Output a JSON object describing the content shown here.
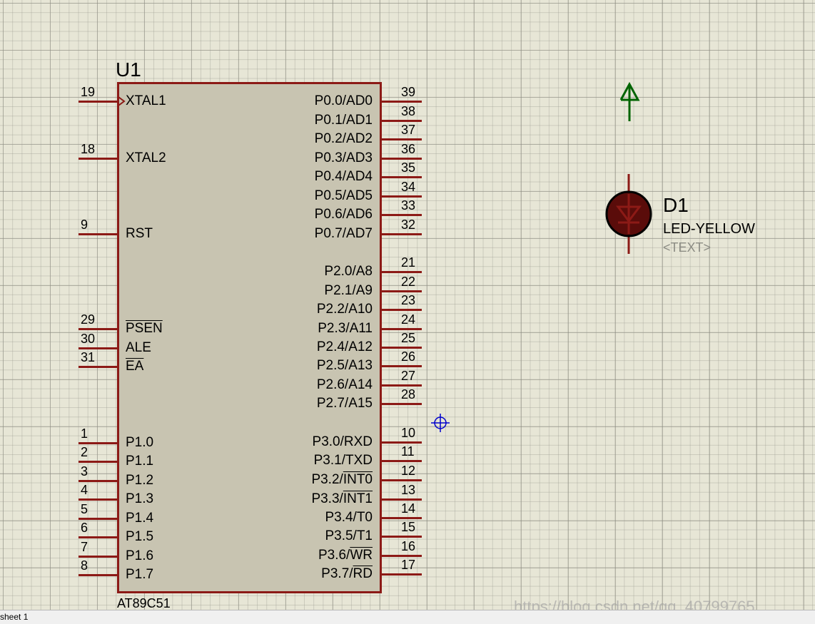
{
  "component": {
    "ref": "U1",
    "part": "AT89C51",
    "left_pins": [
      {
        "num": "19",
        "label": "XTAL1",
        "overline": false,
        "clock": true
      },
      {
        "num": "18",
        "label": "XTAL2",
        "overline": false
      },
      {
        "num": "9",
        "label": "RST",
        "overline": false
      },
      {
        "num": "29",
        "label": "PSEN",
        "overline": true
      },
      {
        "num": "30",
        "label": "ALE",
        "overline": false
      },
      {
        "num": "31",
        "label": "EA",
        "overline": true
      },
      {
        "num": "1",
        "label": "P1.0",
        "overline": false
      },
      {
        "num": "2",
        "label": "P1.1",
        "overline": false
      },
      {
        "num": "3",
        "label": "P1.2",
        "overline": false
      },
      {
        "num": "4",
        "label": "P1.3",
        "overline": false
      },
      {
        "num": "5",
        "label": "P1.4",
        "overline": false
      },
      {
        "num": "6",
        "label": "P1.5",
        "overline": false
      },
      {
        "num": "7",
        "label": "P1.6",
        "overline": false
      },
      {
        "num": "8",
        "label": "P1.7",
        "overline": false
      }
    ],
    "right_pins": [
      {
        "num": "39",
        "label": "P0.0/AD0"
      },
      {
        "num": "38",
        "label": "P0.1/AD1"
      },
      {
        "num": "37",
        "label": "P0.2/AD2"
      },
      {
        "num": "36",
        "label": "P0.3/AD3"
      },
      {
        "num": "35",
        "label": "P0.4/AD4"
      },
      {
        "num": "34",
        "label": "P0.5/AD5"
      },
      {
        "num": "33",
        "label": "P0.6/AD6"
      },
      {
        "num": "32",
        "label": "P0.7/AD7"
      },
      {
        "num": "21",
        "label": "P2.0/A8"
      },
      {
        "num": "22",
        "label": "P2.1/A9"
      },
      {
        "num": "23",
        "label": "P2.2/A10"
      },
      {
        "num": "24",
        "label": "P2.3/A11"
      },
      {
        "num": "25",
        "label": "P2.4/A12"
      },
      {
        "num": "26",
        "label": "P2.5/A13"
      },
      {
        "num": "27",
        "label": "P2.6/A14"
      },
      {
        "num": "28",
        "label": "P2.7/A15"
      },
      {
        "num": "10",
        "label": "P3.0/RXD"
      },
      {
        "num": "11",
        "label": "P3.1/TXD"
      },
      {
        "num": "12",
        "label": "P3.2/",
        "over": "INT0"
      },
      {
        "num": "13",
        "label": "P3.3/",
        "over": "INT1"
      },
      {
        "num": "14",
        "label": "P3.4/T0"
      },
      {
        "num": "15",
        "label": "P3.5/T1"
      },
      {
        "num": "16",
        "label": "P3.6/",
        "over": "WR"
      },
      {
        "num": "17",
        "label": "P3.7/",
        "over": "RD"
      }
    ]
  },
  "led": {
    "ref": "D1",
    "value": "LED-YELLOW",
    "text": "<TEXT>"
  },
  "status_bar": {
    "sheet": "sheet 1"
  },
  "watermark": "https://blog.csdn.net/qq_40799765",
  "colors": {
    "canvas": "#e7e6d6",
    "chip_body": "#c8c4b1",
    "wire": "#8c1a16",
    "power": "#006400",
    "cursor": "#0000cc"
  },
  "icons": [
    "power-terminal-icon",
    "led-diode-icon",
    "crosshair-cursor-icon"
  ]
}
